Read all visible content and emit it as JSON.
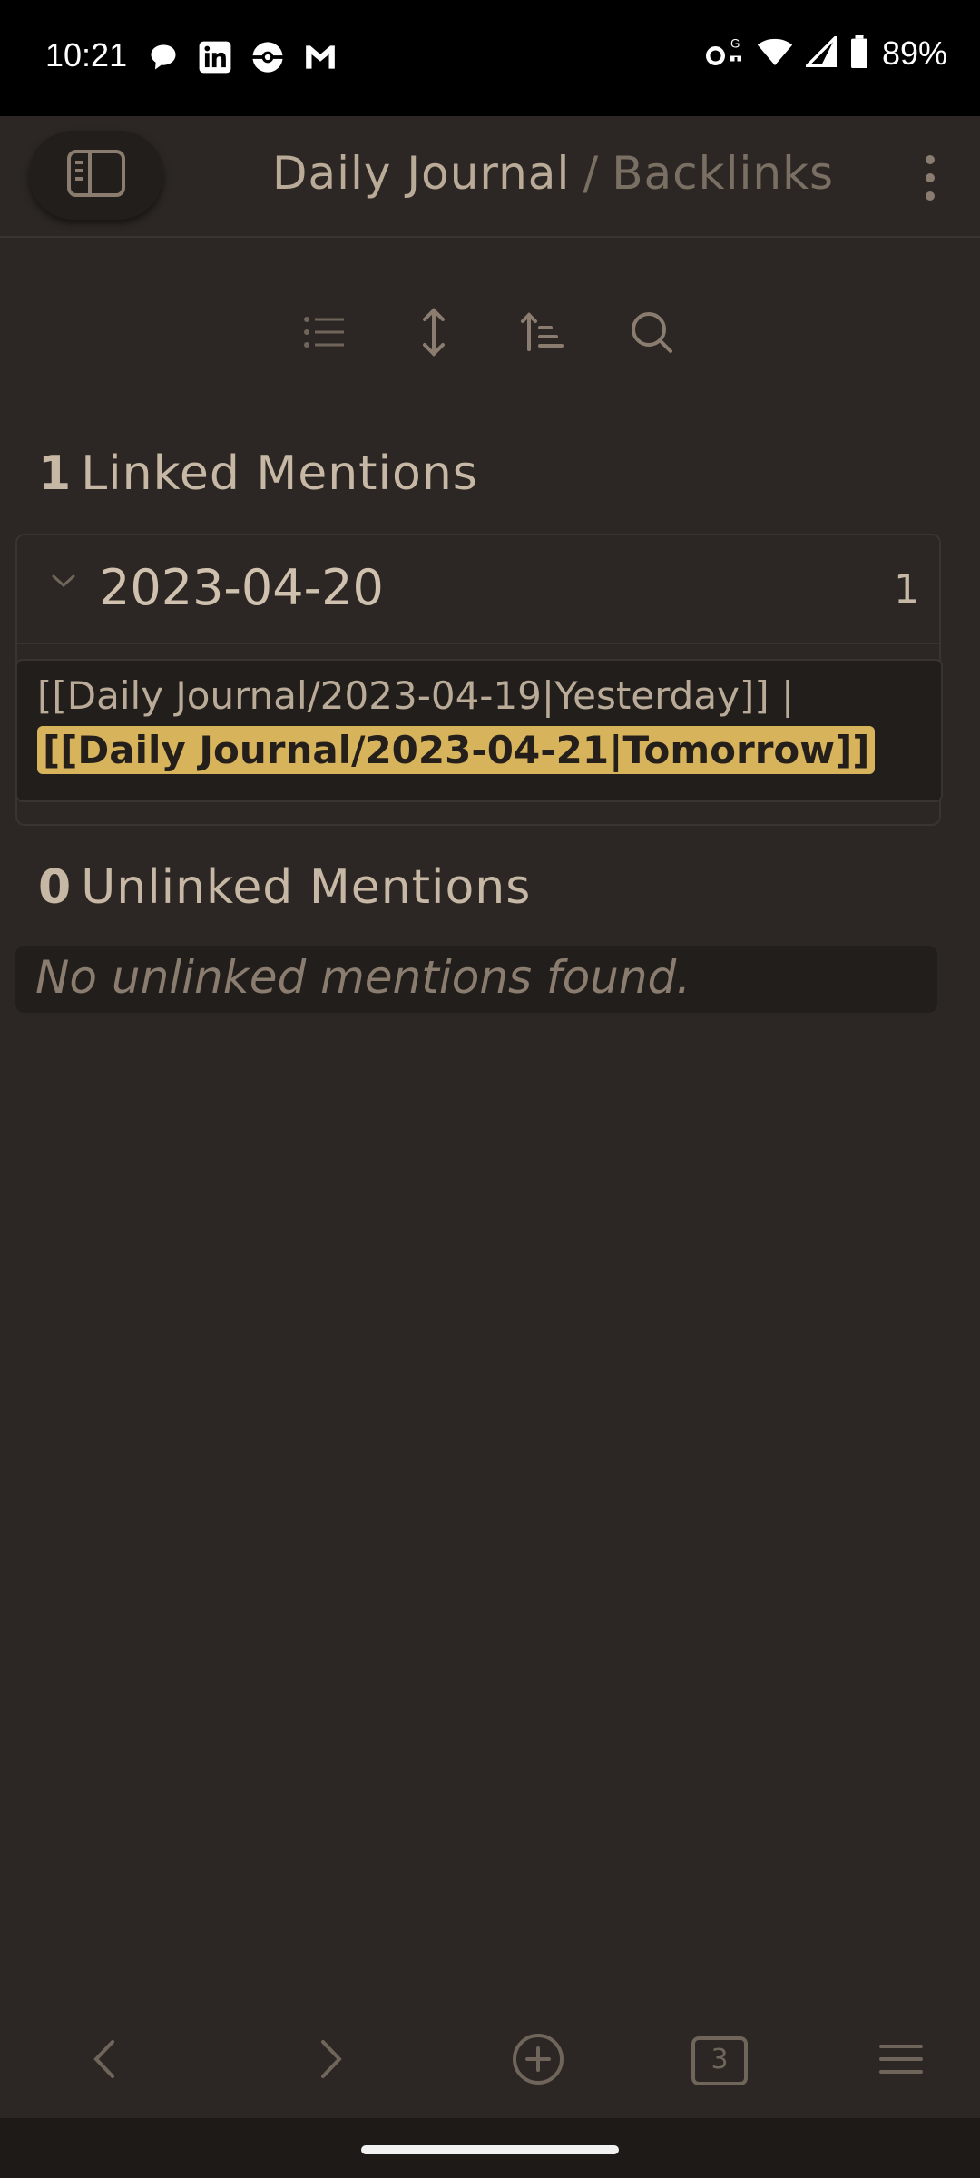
{
  "status_bar": {
    "time": "10:21",
    "battery": "89%",
    "notification_icons": [
      "chat-icon",
      "linkedin-icon",
      "pokeball-icon",
      "gmail-icon"
    ],
    "system_icons": [
      "vpn-key-icon",
      "wifi-icon",
      "signal-icon",
      "battery-icon"
    ]
  },
  "header": {
    "breadcrumb_parent": "Daily Journal",
    "separator": "/",
    "breadcrumb_current": "Backlinks"
  },
  "toolbar": {
    "icons": [
      "list-icon",
      "expand-icon",
      "sort-icon",
      "search-icon"
    ]
  },
  "linked": {
    "count": "1",
    "label": "Linked Mentions",
    "groups": [
      {
        "name": "2023-04-20",
        "count": "1",
        "snippet_text": "[[Daily Journal/2023-04-19|Yesterday]] |",
        "snippet_highlight": "[[Daily Journal/2023-04-21|Tomorrow]]"
      }
    ]
  },
  "unlinked": {
    "count": "0",
    "label": "Unlinked Mentions",
    "empty_text": "No unlinked mentions found."
  },
  "bottom_nav": {
    "tabs_count": "3",
    "icons": [
      "back-icon",
      "forward-icon",
      "new-note-icon",
      "tabs-icon",
      "menu-icon"
    ]
  },
  "colors": {
    "background": "#2c2724",
    "highlight": "#d7b45c",
    "text": "#c6b8a4"
  }
}
